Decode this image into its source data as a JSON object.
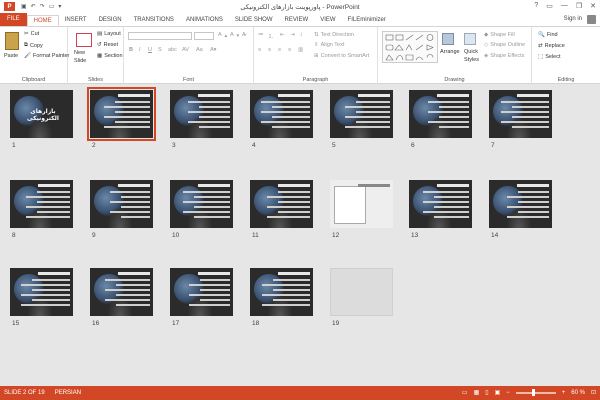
{
  "window": {
    "title": "پاورپوینت بازارهای الکترونیکی - PowerPoint",
    "app_icon": "P",
    "controls": [
      "?",
      "▭",
      "—",
      "❐",
      "✕"
    ]
  },
  "tabs": [
    "FILE",
    "HOME",
    "INSERT",
    "DESIGN",
    "TRANSITIONS",
    "ANIMATIONS",
    "SLIDE SHOW",
    "REVIEW",
    "VIEW",
    "FILEminimizer"
  ],
  "active_tab": "HOME",
  "signin": "Sign in",
  "ribbon": {
    "clipboard": {
      "paste": "Paste",
      "cut": "Cut",
      "copy": "Copy",
      "format_painter": "Format Painter",
      "group": "Clipboard"
    },
    "slides": {
      "new_slide": "New",
      "new_slide2": "Slide",
      "layout": "Layout",
      "reset": "Reset",
      "section": "Section",
      "group": "Slides"
    },
    "font": {
      "group": "Font",
      "font_name": "",
      "font_size": ""
    },
    "paragraph": {
      "text_direction": "Text Direction",
      "align_text": "Align Text",
      "convert_smartart": "Convert to SmartArt",
      "group": "Paragraph"
    },
    "drawing": {
      "arrange": "Arrange",
      "quick_styles_1": "Quick",
      "quick_styles_2": "Styles",
      "shape_fill": "Shape Fill",
      "shape_outline": "Shape Outline",
      "shape_effects": "Shape Effects",
      "group": "Drawing"
    },
    "editing": {
      "find": "Find",
      "replace": "Replace",
      "select": "Select",
      "group": "Editing"
    }
  },
  "slides": [
    {
      "num": "1",
      "kind": "cover",
      "text": "بازارهای الکترونیکی"
    },
    {
      "num": "2",
      "kind": "text",
      "selected": true
    },
    {
      "num": "3",
      "kind": "text"
    },
    {
      "num": "4",
      "kind": "text"
    },
    {
      "num": "5",
      "kind": "text"
    },
    {
      "num": "6",
      "kind": "text"
    },
    {
      "num": "7",
      "kind": "text"
    },
    {
      "num": "8",
      "kind": "text"
    },
    {
      "num": "9",
      "kind": "text"
    },
    {
      "num": "10",
      "kind": "text"
    },
    {
      "num": "11",
      "kind": "text"
    },
    {
      "num": "12",
      "kind": "doc"
    },
    {
      "num": "13",
      "kind": "text"
    },
    {
      "num": "14",
      "kind": "text"
    },
    {
      "num": "15",
      "kind": "text"
    },
    {
      "num": "16",
      "kind": "text"
    },
    {
      "num": "17",
      "kind": "text"
    },
    {
      "num": "18",
      "kind": "text"
    },
    {
      "num": "19",
      "kind": "laptop"
    }
  ],
  "status": {
    "slide_info": "SLIDE 2 OF 19",
    "language": "PERSIAN",
    "zoom": "60 %",
    "zoom_minus": "−",
    "zoom_plus": "+"
  },
  "colors": {
    "accent": "#d24726"
  }
}
